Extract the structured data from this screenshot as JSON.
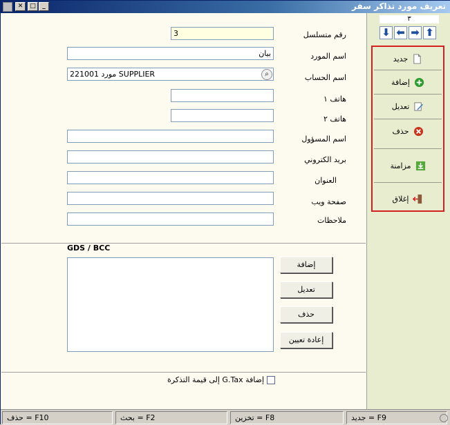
{
  "window": {
    "title": "تعريف مورد تذاكر سفر"
  },
  "toolbar": {
    "counter": "٣",
    "nav": [
      {
        "name": "nav-last-button",
        "glyph": "⬇",
        "icon": "arrow-down-icon"
      },
      {
        "name": "nav-prev-button",
        "glyph": "⬅",
        "icon": "arrow-left-icon"
      },
      {
        "name": "nav-next-button",
        "glyph": "➡",
        "icon": "arrow-right-icon"
      },
      {
        "name": "nav-first-button",
        "glyph": "⬆",
        "icon": "arrow-up-icon"
      }
    ],
    "actions": {
      "new": "جديد",
      "add": "إضافة",
      "edit": "تعديل",
      "delete": "حذف",
      "sync": "مزامنة",
      "close": "إغلاق"
    }
  },
  "form": {
    "serial_label": "رقم متسلسل",
    "serial_value": "3",
    "supplier_name_label": "اسم المورد",
    "supplier_name_value": "بيان",
    "account_name_label": "اسم الحساب",
    "account_name_value": "221001 مورد SUPPLIER",
    "phone1_label": "هاتف ١",
    "phone1_value": "",
    "phone2_label": "هاتف ٢",
    "phone2_value": "",
    "responsible_label": "اسم المسؤول",
    "responsible_value": "",
    "email_label": "بريد الكتروني",
    "email_value": "",
    "address_label": "العنوان",
    "address_value": "",
    "website_label": "صفحة ويب",
    "website_value": "",
    "notes_label": "ملاحظات",
    "notes_value": ""
  },
  "gds": {
    "title": "GDS / BCC",
    "buttons": {
      "add": "إضافة",
      "edit": "تعديل",
      "delete": "حذف",
      "reassign": "إعادة تعيين"
    }
  },
  "gtax": {
    "label": "إضافة G.Tax إلى قيمة التذكرة",
    "checked": false
  },
  "statusbar": {
    "new": "F9 = جديد",
    "store": "F8 = تخزين",
    "search": "F2 = بحث",
    "delete": "F10 = حذف"
  },
  "colors": {
    "accent_red": "#d42020",
    "panel_bg": "#e9edcf",
    "form_bg": "#fdfaf0",
    "highlight_field": "#ffffe1"
  }
}
